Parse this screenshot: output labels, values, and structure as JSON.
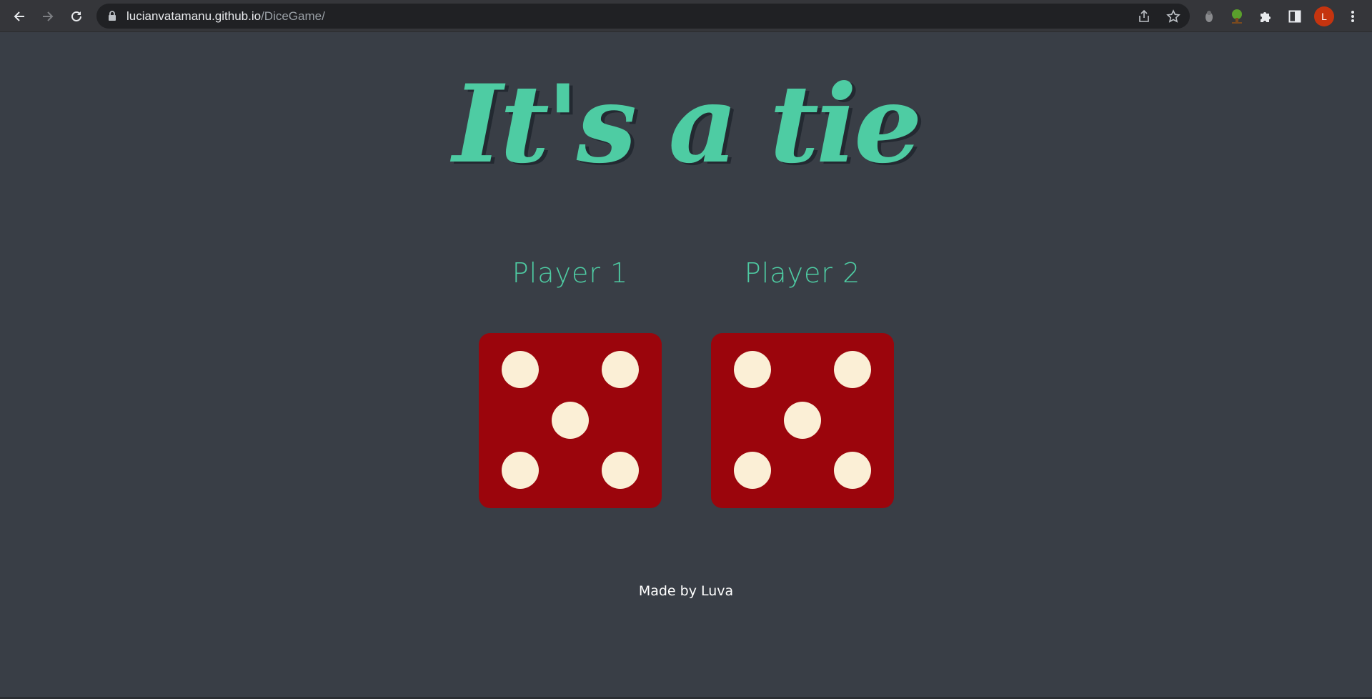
{
  "browser": {
    "url_host": "lucianvatamanu.github.io",
    "url_path": "/DiceGame/",
    "profile_initial": "L",
    "icons": {
      "back": "back-arrow-icon",
      "forward": "forward-arrow-icon",
      "reload": "reload-icon",
      "lock": "lock-icon",
      "share": "share-icon",
      "bookmark": "star-icon",
      "extension_1": "extension-grey-icon",
      "extension_2": "tree-extension-icon",
      "extensions": "puzzle-icon",
      "side_panel": "side-panel-icon",
      "menu": "kebab-menu-icon"
    }
  },
  "page": {
    "title": "It's a tie",
    "players": [
      {
        "label": "Player 1",
        "die_value": 5
      },
      {
        "label": "Player 2",
        "die_value": 5
      }
    ],
    "footer": "Made by Luva"
  },
  "colors": {
    "background": "#393e46",
    "accent": "#4ecca3",
    "title_shadow": "#232931",
    "die": "#9b050c",
    "pip": "#fbefd6"
  }
}
